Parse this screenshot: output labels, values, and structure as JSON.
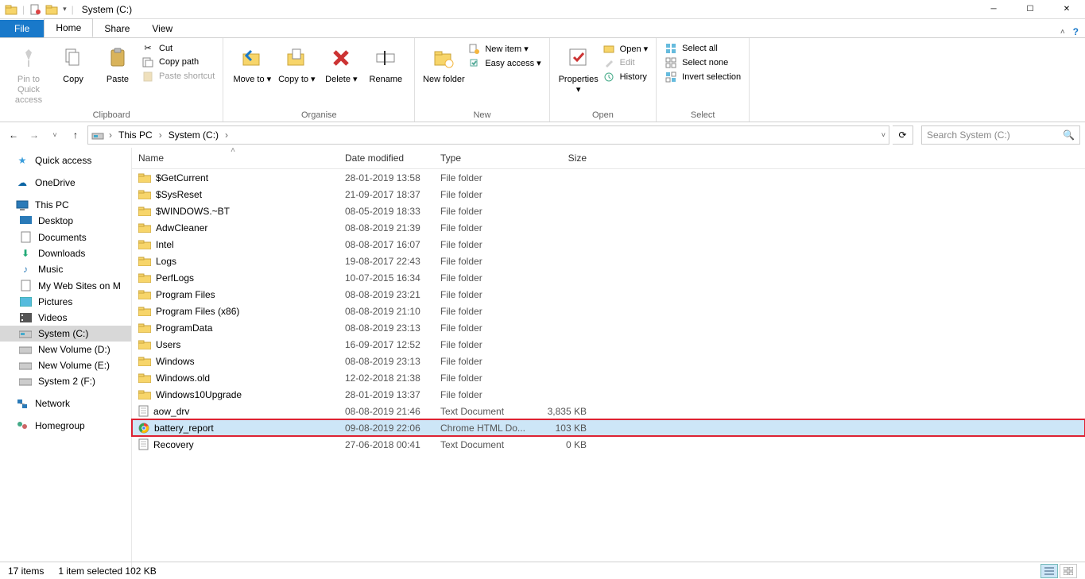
{
  "window": {
    "title": "System (C:)"
  },
  "tabs": {
    "file": "File",
    "home": "Home",
    "share": "Share",
    "view": "View"
  },
  "ribbon": {
    "clipboard": {
      "label": "Clipboard",
      "pin": "Pin to Quick access",
      "copy": "Copy",
      "paste": "Paste",
      "cut": "Cut",
      "copy_path": "Copy path",
      "paste_shortcut": "Paste shortcut"
    },
    "organise": {
      "label": "Organise",
      "move_to": "Move to ▾",
      "copy_to": "Copy to ▾",
      "delete": "Delete ▾",
      "rename": "Rename"
    },
    "new": {
      "label": "New",
      "new_folder": "New folder",
      "new_item": "New item ▾",
      "easy_access": "Easy access ▾"
    },
    "open": {
      "label": "Open",
      "properties": "Properties ▾",
      "open": "Open ▾",
      "edit": "Edit",
      "history": "History"
    },
    "select": {
      "label": "Select",
      "select_all": "Select all",
      "select_none": "Select none",
      "invert": "Invert selection"
    }
  },
  "breadcrumbs": [
    "This PC",
    "System (C:)"
  ],
  "search": {
    "placeholder": "Search System (C:)"
  },
  "columns": {
    "name": "Name",
    "date": "Date modified",
    "type": "Type",
    "size": "Size"
  },
  "sidebar": {
    "quick_access": "Quick access",
    "onedrive": "OneDrive",
    "this_pc": "This PC",
    "desktop": "Desktop",
    "documents": "Documents",
    "downloads": "Downloads",
    "music": "Music",
    "mywebsites": "My Web Sites on M",
    "pictures": "Pictures",
    "videos": "Videos",
    "system_c": "System (C:)",
    "new_vol_d": "New Volume (D:)",
    "new_vol_e": "New Volume (E:)",
    "system2_f": "System 2 (F:)",
    "network": "Network",
    "homegroup": "Homegroup"
  },
  "rows": [
    {
      "icon": "folder",
      "name": "$GetCurrent",
      "date": "28-01-2019 13:58",
      "type": "File folder",
      "size": ""
    },
    {
      "icon": "folder",
      "name": "$SysReset",
      "date": "21-09-2017 18:37",
      "type": "File folder",
      "size": ""
    },
    {
      "icon": "folder",
      "name": "$WINDOWS.~BT",
      "date": "08-05-2019 18:33",
      "type": "File folder",
      "size": ""
    },
    {
      "icon": "folder",
      "name": "AdwCleaner",
      "date": "08-08-2019 21:39",
      "type": "File folder",
      "size": ""
    },
    {
      "icon": "folder",
      "name": "Intel",
      "date": "08-08-2017 16:07",
      "type": "File folder",
      "size": ""
    },
    {
      "icon": "folder",
      "name": "Logs",
      "date": "19-08-2017 22:43",
      "type": "File folder",
      "size": ""
    },
    {
      "icon": "folder",
      "name": "PerfLogs",
      "date": "10-07-2015 16:34",
      "type": "File folder",
      "size": ""
    },
    {
      "icon": "folder",
      "name": "Program Files",
      "date": "08-08-2019 23:21",
      "type": "File folder",
      "size": ""
    },
    {
      "icon": "folder",
      "name": "Program Files (x86)",
      "date": "08-08-2019 21:10",
      "type": "File folder",
      "size": ""
    },
    {
      "icon": "folder",
      "name": "ProgramData",
      "date": "08-08-2019 23:13",
      "type": "File folder",
      "size": ""
    },
    {
      "icon": "folder",
      "name": "Users",
      "date": "16-09-2017 12:52",
      "type": "File folder",
      "size": ""
    },
    {
      "icon": "folder",
      "name": "Windows",
      "date": "08-08-2019 23:13",
      "type": "File folder",
      "size": ""
    },
    {
      "icon": "folder",
      "name": "Windows.old",
      "date": "12-02-2018 21:38",
      "type": "File folder",
      "size": ""
    },
    {
      "icon": "folder",
      "name": "Windows10Upgrade",
      "date": "28-01-2019 13:37",
      "type": "File folder",
      "size": ""
    },
    {
      "icon": "text",
      "name": "aow_drv",
      "date": "08-08-2019 21:46",
      "type": "Text Document",
      "size": "3,835 KB"
    },
    {
      "icon": "chrome",
      "name": "battery_report",
      "date": "09-08-2019 22:06",
      "type": "Chrome HTML Do...",
      "size": "103 KB",
      "selected": true,
      "marked": true
    },
    {
      "icon": "text",
      "name": "Recovery",
      "date": "27-06-2018 00:41",
      "type": "Text Document",
      "size": "0 KB"
    }
  ],
  "status": {
    "items": "17 items",
    "selected": "1 item selected  102 KB"
  }
}
